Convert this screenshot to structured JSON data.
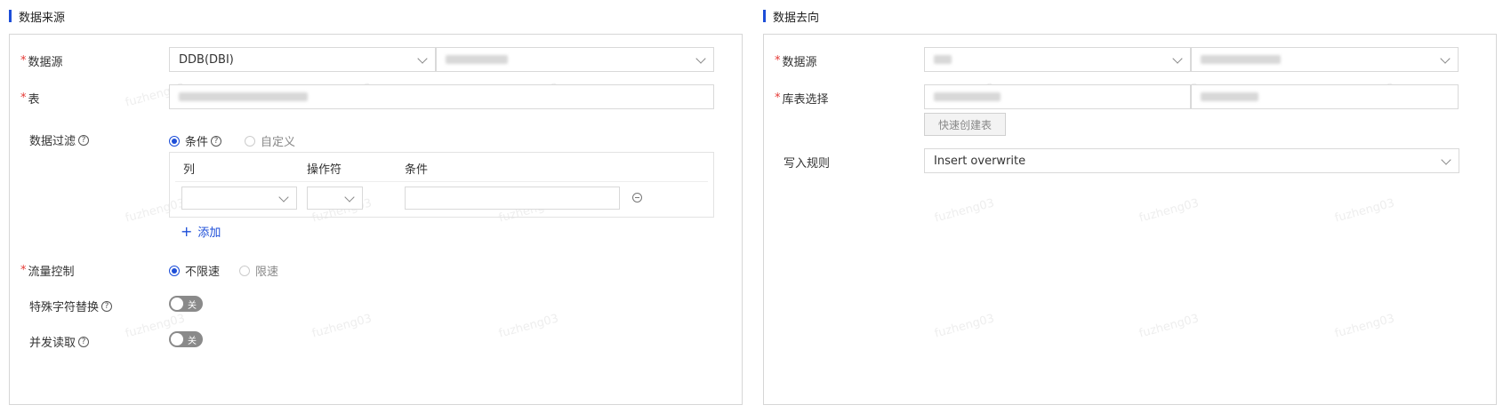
{
  "source": {
    "title": "数据来源",
    "fields": {
      "datasource_label": "数据源",
      "datasource_type": "DDB(DBI)",
      "table_label": "表",
      "filter_label": "数据过滤",
      "filter_options": [
        "条件",
        "自定义"
      ],
      "flow_label": "流量控制",
      "flow_options": [
        "不限速",
        "限速"
      ],
      "special_char_label": "特殊字符替换",
      "concurrent_label": "并发读取",
      "toggle_off_text": "关"
    },
    "filter_table": {
      "headers": [
        "列",
        "操作符",
        "条件"
      ],
      "add_label": "添加"
    }
  },
  "target": {
    "title": "数据去向",
    "fields": {
      "datasource_label": "数据源",
      "table_label": "库表选择",
      "quick_create_label": "快速创建表",
      "write_rule_label": "写入规则",
      "write_rule_value": "Insert overwrite"
    }
  },
  "watermark": "fuzheng03",
  "colors": {
    "accent": "#1d4ed8",
    "required": "#e53935",
    "toggle_off": "#8a8a8a"
  }
}
